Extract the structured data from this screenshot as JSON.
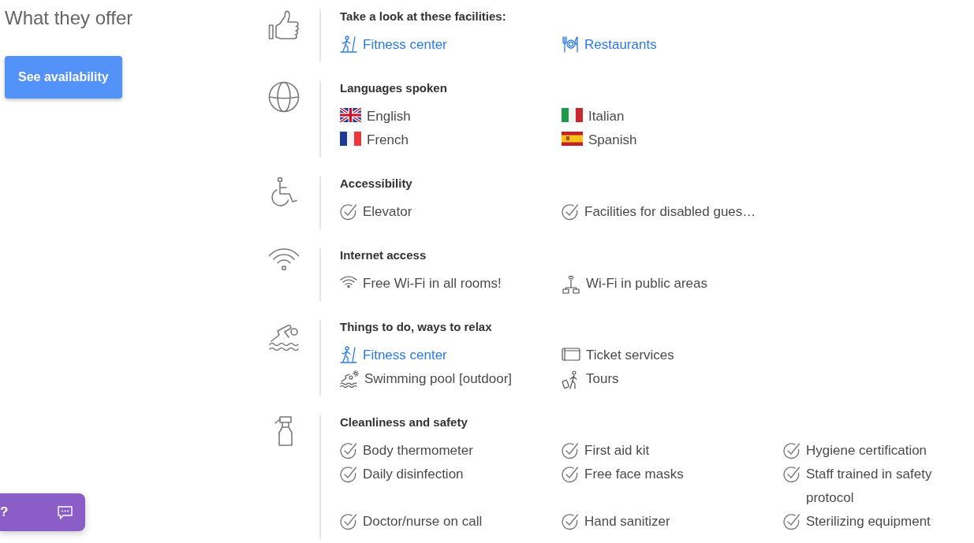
{
  "sidebar": {
    "heading": "What they offer",
    "button": "See availability"
  },
  "sections": [
    {
      "kind": "facilities",
      "title": "Take a look at these facilities:",
      "items": [
        {
          "label": "Fitness center",
          "kind": "fitness",
          "link": true
        },
        {
          "label": "Restaurants",
          "kind": "dining",
          "link": true
        }
      ]
    },
    {
      "kind": "languages",
      "title": "Languages spoken",
      "items": [
        {
          "label": "English",
          "kind": "britain",
          "link": false
        },
        {
          "label": "Italian",
          "kind": "italy",
          "link": false
        },
        {
          "label": "French",
          "kind": "france",
          "link": false
        },
        {
          "label": "Spanish",
          "kind": "spain",
          "link": false
        }
      ]
    },
    {
      "kind": "accessibility",
      "title": "Accessibility",
      "items": [
        {
          "label": "Elevator",
          "kind": "check",
          "link": false
        },
        {
          "label": "Facilities for disabled gues…",
          "kind": "check",
          "link": false
        }
      ]
    },
    {
      "kind": "internet",
      "title": "Internet access",
      "items": [
        {
          "label": "Free Wi-Fi in all rooms!",
          "kind": "wifi",
          "link": false
        },
        {
          "label": "Wi-Fi in public areas",
          "kind": "hotspot",
          "link": false
        }
      ]
    },
    {
      "kind": "activities",
      "title": "Things to do, ways to relax",
      "items": [
        {
          "label": "Fitness center",
          "kind": "fitness",
          "link": true
        },
        {
          "label": "Ticket services",
          "kind": "ticket",
          "link": false
        },
        {
          "label": "Swimming pool [outdoor]",
          "kind": "pool",
          "link": false
        },
        {
          "label": "Tours",
          "kind": "tours",
          "link": false
        }
      ]
    },
    {
      "kind": "cleanliness",
      "title": "Cleanliness and safety",
      "items": [
        {
          "label": "Body thermometer",
          "kind": "check",
          "link": false
        },
        {
          "label": "First aid kit",
          "kind": "check",
          "link": false
        },
        {
          "label": "Hygiene certification",
          "kind": "check",
          "link": false
        },
        {
          "label": "Daily disinfection",
          "kind": "check",
          "link": false
        },
        {
          "label": "Free face masks",
          "kind": "check",
          "link": false
        },
        {
          "label": "Staff trained in safety protocol",
          "kind": "check",
          "link": false
        },
        {
          "label": "Doctor/nurse on call",
          "kind": "check",
          "link": false
        },
        {
          "label": "Hand sanitizer",
          "kind": "check",
          "link": false
        },
        {
          "label": "Sterilizing equipment",
          "kind": "check",
          "link": false
        }
      ]
    }
  ],
  "chat": {
    "label": "?"
  }
}
